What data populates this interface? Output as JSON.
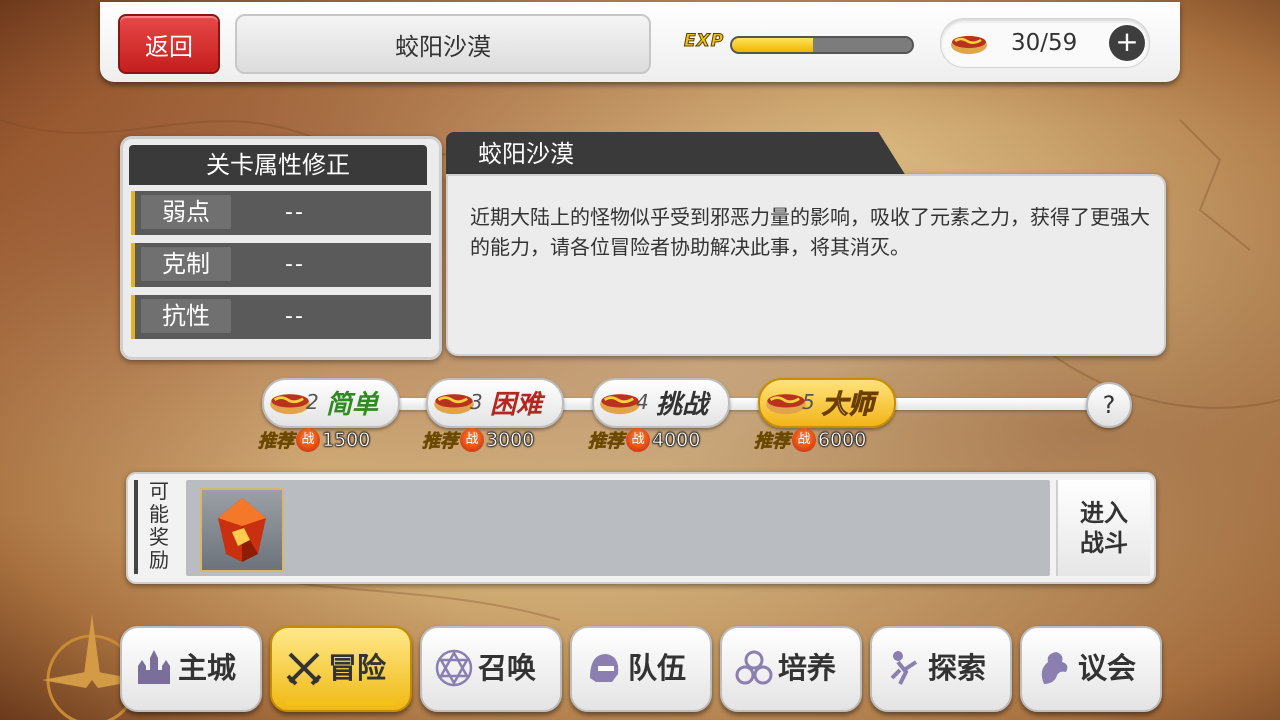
{
  "topbar": {
    "back_label": "返回",
    "stage_title": "蛟阳沙漠",
    "exp_label": "EXP",
    "exp_progress": 0.45,
    "stamina": "30/59",
    "plus_label": "+"
  },
  "attributes": {
    "title": "关卡属性修正",
    "rows": [
      {
        "name": "弱点",
        "value": "--"
      },
      {
        "name": "克制",
        "value": "--"
      },
      {
        "name": "抗性",
        "value": "--"
      }
    ]
  },
  "description": {
    "title": "蛟阳沙漠",
    "text": "近期大陆上的怪物似乎受到邪恶力量的影响，吸收了元素之力，获得了更强大的能力，请各位冒险者协助解决此事，将其消灭。"
  },
  "difficulties": [
    {
      "num": "2",
      "name": "简单",
      "rec_label": "推荐",
      "rec_badge": "战",
      "power": "1500",
      "color": "green",
      "selected": false
    },
    {
      "num": "3",
      "name": "困难",
      "rec_label": "推荐",
      "rec_badge": "战",
      "power": "3000",
      "color": "red",
      "selected": false
    },
    {
      "num": "4",
      "name": "挑战",
      "rec_label": "推荐",
      "rec_badge": "战",
      "power": "4000",
      "color": "dark",
      "selected": false
    },
    {
      "num": "5",
      "name": "大师",
      "rec_label": "推荐",
      "rec_badge": "战",
      "power": "6000",
      "color": "gold",
      "selected": true
    }
  ],
  "help_label": "?",
  "rewards": {
    "label": "可能奖励",
    "items": [
      {
        "icon": "red-crystal-icon"
      }
    ],
    "fight_label_1": "进入",
    "fight_label_2": "战斗"
  },
  "nav": [
    {
      "label": "主城",
      "icon": "castle-icon",
      "active": false
    },
    {
      "label": "冒险",
      "icon": "crossed-swords-icon",
      "active": true
    },
    {
      "label": "召唤",
      "icon": "hexagram-icon",
      "active": false
    },
    {
      "label": "队伍",
      "icon": "helmet-icon",
      "active": false
    },
    {
      "label": "培养",
      "icon": "triple-circle-icon",
      "active": false
    },
    {
      "label": "探索",
      "icon": "explorer-icon",
      "active": false
    },
    {
      "label": "议会",
      "icon": "dragon-icon",
      "active": false
    }
  ],
  "colors": {
    "accent_gold": "#f2c21b",
    "back_red": "#d32f2f",
    "panel_dark": "#3a3a3a"
  }
}
